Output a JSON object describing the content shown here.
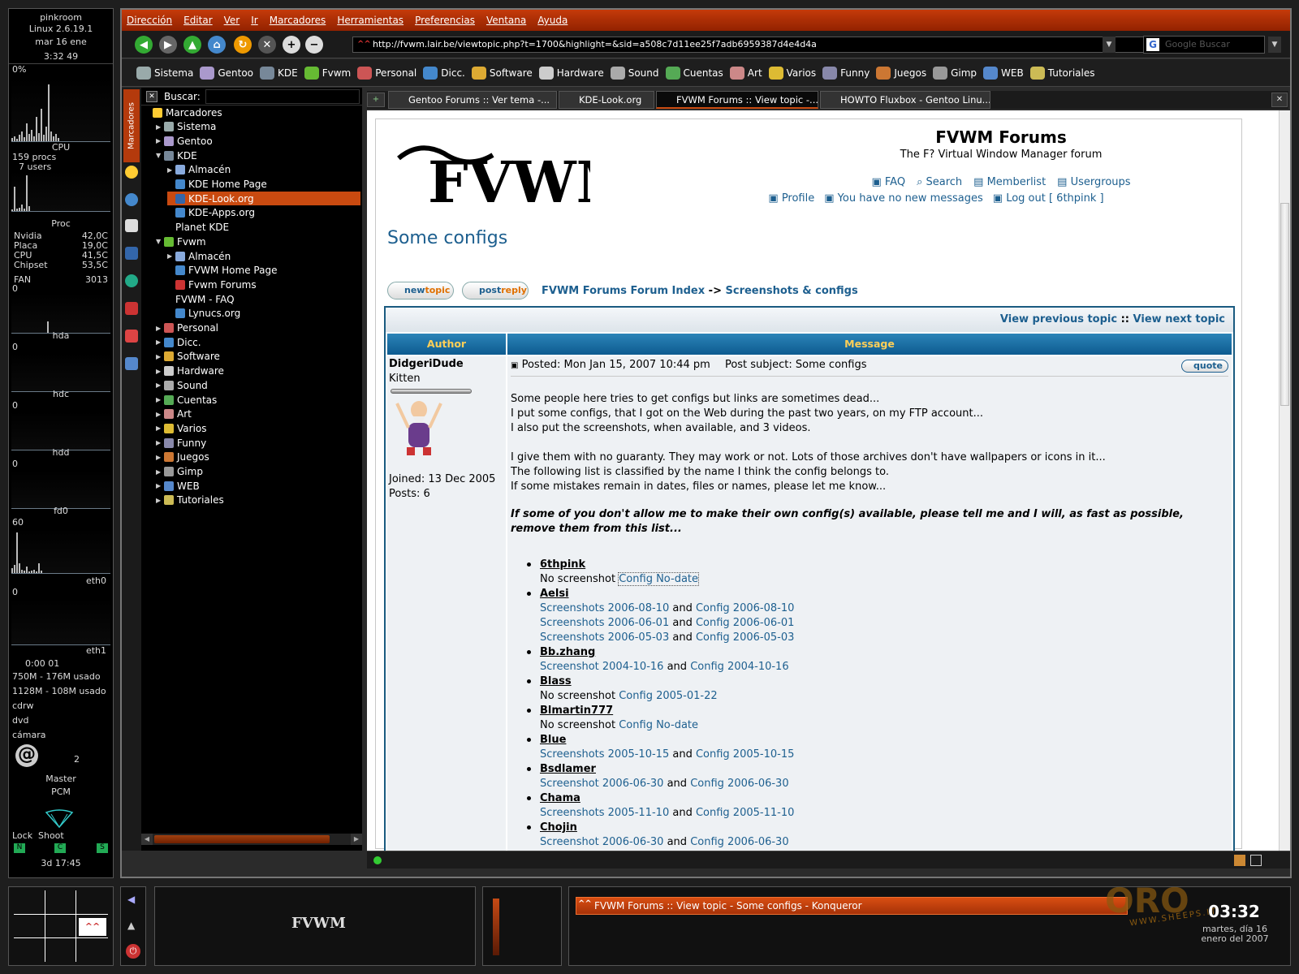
{
  "conky": {
    "host": "pinkroom",
    "kernel": "Linux 2.6.19.1",
    "date": "mar 16 ene",
    "time": "3:32 49",
    "cpu_pct": "0%",
    "cpu_label": "CPU",
    "procs": "159 procs",
    "users": "7 users",
    "proc_label": "Proc",
    "temps": [
      {
        "k": "Nvidia",
        "v": "42,0C"
      },
      {
        "k": "Placa",
        "v": "19,0C"
      },
      {
        "k": "CPU",
        "v": "41,5C"
      },
      {
        "k": "Chipset",
        "v": "53,5C"
      },
      {
        "k": "FAN",
        "v": "3013"
      }
    ],
    "disk_zero": "0",
    "hda": "hda",
    "hdc": "hdc",
    "hdd": "hdd",
    "fd0": "fd0",
    "net_max": "60",
    "eth0": "eth0",
    "eth1": "eth1",
    "uptime_small": "0:00 01",
    "mem1": "750M - 176M usado",
    "mem2": "1128M - 108M usado",
    "dev1": "cdrw",
    "dev2": "dvd",
    "dev3": "cámara",
    "mail_count": "2",
    "mixer1": "Master",
    "mixer2": "PCM",
    "lock": "Lock",
    "shoot": "Shoot",
    "keys": [
      "N",
      "C",
      "S"
    ],
    "uptime": "3d 17:45"
  },
  "menu": [
    "Dirección",
    "Editar",
    "Ver",
    "Ir",
    "Marcadores",
    "Herramientas",
    "Preferencias",
    "Ventana",
    "Ayuda"
  ],
  "url": "http://fvwm.lair.be/viewtopic.php?t=1700&highlight=&sid=a508c7d11ee25f7adb6959387d4e4d4a",
  "google_placeholder": "Google Buscar",
  "bookbar": [
    {
      "label": "Sistema",
      "color": "#9aa"
    },
    {
      "label": "Gentoo",
      "color": "#a9c"
    },
    {
      "label": "KDE",
      "color": "#789"
    },
    {
      "label": "Fvwm",
      "color": "#6b3"
    },
    {
      "label": "Personal",
      "color": "#c55"
    },
    {
      "label": "Dicc.",
      "color": "#48c"
    },
    {
      "label": "Software",
      "color": "#da3"
    },
    {
      "label": "Hardware",
      "color": "#ccc"
    },
    {
      "label": "Sound",
      "color": "#aaa"
    },
    {
      "label": "Cuentas",
      "color": "#5a5"
    },
    {
      "label": "Art",
      "color": "#c88"
    },
    {
      "label": "Varios",
      "color": "#db3"
    },
    {
      "label": "Funny",
      "color": "#88a"
    },
    {
      "label": "Juegos",
      "color": "#c73"
    },
    {
      "label": "Gimp",
      "color": "#999"
    },
    {
      "label": "WEB",
      "color": "#58c"
    },
    {
      "label": "Tutoriales",
      "color": "#cb5"
    }
  ],
  "sidebar_tab": "Marcadores",
  "tree": {
    "search_label": "Buscar:",
    "rows": [
      {
        "label": "Marcadores",
        "depth": 0,
        "arrow": "",
        "color": "#fc3"
      },
      {
        "label": "Sistema",
        "depth": 1,
        "arrow": "▶",
        "color": "#9aa"
      },
      {
        "label": "Gentoo",
        "depth": 1,
        "arrow": "▶",
        "color": "#a9c"
      },
      {
        "label": "KDE",
        "depth": 1,
        "arrow": "▼",
        "color": "#789"
      },
      {
        "label": "Almacén",
        "depth": 2,
        "arrow": "▶",
        "color": "#8ad"
      },
      {
        "label": "KDE Home Page",
        "depth": 2,
        "arrow": "",
        "color": "#48c"
      },
      {
        "label": "KDE-Look.org",
        "depth": 2,
        "arrow": "",
        "color": "#36a",
        "selected": true
      },
      {
        "label": "KDE-Apps.org",
        "depth": 2,
        "arrow": "",
        "color": "#48c"
      },
      {
        "label": "Planet KDE",
        "depth": 2,
        "arrow": "",
        "color": ""
      },
      {
        "label": "Fvwm",
        "depth": 1,
        "arrow": "▼",
        "color": "#6b3"
      },
      {
        "label": "Almacén",
        "depth": 2,
        "arrow": "▶",
        "color": "#8ad"
      },
      {
        "label": "FVWM Home Page",
        "depth": 2,
        "arrow": "",
        "color": "#48c"
      },
      {
        "label": "Fvwm Forums",
        "depth": 2,
        "arrow": "",
        "color": "#c33"
      },
      {
        "label": "FVWM - FAQ",
        "depth": 2,
        "arrow": "",
        "color": ""
      },
      {
        "label": "Lynucs.org",
        "depth": 2,
        "arrow": "",
        "color": "#48c"
      },
      {
        "label": "Personal",
        "depth": 1,
        "arrow": "▶",
        "color": "#c55"
      },
      {
        "label": "Dicc.",
        "depth": 1,
        "arrow": "▶",
        "color": "#48c"
      },
      {
        "label": "Software",
        "depth": 1,
        "arrow": "▶",
        "color": "#da3"
      },
      {
        "label": "Hardware",
        "depth": 1,
        "arrow": "▶",
        "color": "#ccc"
      },
      {
        "label": "Sound",
        "depth": 1,
        "arrow": "▶",
        "color": "#aaa"
      },
      {
        "label": "Cuentas",
        "depth": 1,
        "arrow": "▶",
        "color": "#5a5"
      },
      {
        "label": "Art",
        "depth": 1,
        "arrow": "▶",
        "color": "#c88"
      },
      {
        "label": "Varios",
        "depth": 1,
        "arrow": "▶",
        "color": "#db3"
      },
      {
        "label": "Funny",
        "depth": 1,
        "arrow": "▶",
        "color": "#88a"
      },
      {
        "label": "Juegos",
        "depth": 1,
        "arrow": "▶",
        "color": "#c73"
      },
      {
        "label": "Gimp",
        "depth": 1,
        "arrow": "▶",
        "color": "#999"
      },
      {
        "label": "WEB",
        "depth": 1,
        "arrow": "▶",
        "color": "#58c"
      },
      {
        "label": "Tutoriales",
        "depth": 1,
        "arrow": "▶",
        "color": "#cb5"
      }
    ]
  },
  "tabs": [
    {
      "label": "Gentoo Forums :: Ver tema -...",
      "active": false
    },
    {
      "label": "KDE-Look.org",
      "active": false
    },
    {
      "label": "FVWM Forums :: View topic -...",
      "active": true
    },
    {
      "label": "HOWTO Fluxbox - Gentoo Linu...",
      "active": false
    }
  ],
  "forum": {
    "logo": "FVWM",
    "title": "FVWM Forums",
    "subtitle": "The F? Virtual Window Manager forum",
    "nav1": [
      "FAQ",
      "Search",
      "Memberlist",
      "Usergroups"
    ],
    "nav2": [
      "Profile",
      "You have no new messages",
      "Log out [ 6thpink ]"
    ],
    "topic_title": "Some configs",
    "newtopic_a": "new",
    "newtopic_b": "topic",
    "postreply_a": "post",
    "postreply_b": "reply",
    "crumb_index": "FVWM Forums Forum Index",
    "crumb_sep": "->",
    "crumb_forum": "Screenshots & configs",
    "view_prev": "View previous topic",
    "view_sep": "::",
    "view_next": "View next topic",
    "col_author": "Author",
    "col_message": "Message",
    "author": "DidgeriDude",
    "rank": "Kitten",
    "joined": "Joined: 13 Dec 2005",
    "posts": "Posts: 6",
    "posted": "Posted: Mon Jan 15, 2007 10:44 pm",
    "subject": "Post subject: Some configs",
    "quote": "quote",
    "para1": [
      "Some people here tries to get configs but links are sometimes dead...",
      "I put some configs, that I got on the Web during the past two years, on my FTP account...",
      "I also put the screenshots, when available, and 3 videos."
    ],
    "para2": [
      "I give them with no guaranty. They may work or not. Lots of those archives don't have wallpapers or icons in it...",
      "The following list is classified by the name I think the config belongs to.",
      "If some mistakes remain in dates, files or names, please let me know..."
    ],
    "warning": "If some of you don't allow me to make their own config(s) available, please tell me and I will, as fast as possible, remove them from this list...",
    "entries": [
      {
        "name": "6thpink",
        "lines": [
          {
            "pre": "No screenshot",
            "link1": "",
            "and": "",
            "link2": "Config No-date"
          }
        ]
      },
      {
        "name": "Aelsi",
        "lines": [
          {
            "pre": "",
            "link1": "Screenshots 2006-08-10",
            "and": "and",
            "link2": "Config 2006-08-10"
          },
          {
            "pre": "",
            "link1": "Screenshots 2006-06-01",
            "and": "and",
            "link2": "Config 2006-06-01"
          },
          {
            "pre": "",
            "link1": "Screenshots 2006-05-03",
            "and": "and",
            "link2": "Config 2006-05-03"
          }
        ]
      },
      {
        "name": "Bb.zhang",
        "lines": [
          {
            "pre": "",
            "link1": "Screenshot 2004-10-16",
            "and": "and",
            "link2": "Config 2004-10-16"
          }
        ]
      },
      {
        "name": "Blass",
        "lines": [
          {
            "pre": "No screenshot",
            "link1": "",
            "and": "",
            "link2": "Config 2005-01-22"
          }
        ]
      },
      {
        "name": "Blmartin777",
        "lines": [
          {
            "pre": "No screenshot",
            "link1": "",
            "and": "",
            "link2": "Config No-date"
          }
        ]
      },
      {
        "name": "Blue",
        "lines": [
          {
            "pre": "",
            "link1": "Screenshots 2005-10-15",
            "and": "and",
            "link2": "Config 2005-10-15"
          }
        ]
      },
      {
        "name": "Bsdlamer",
        "lines": [
          {
            "pre": "",
            "link1": "Screenshot 2006-06-30",
            "and": "and",
            "link2": "Config 2006-06-30"
          }
        ]
      },
      {
        "name": "Chama",
        "lines": [
          {
            "pre": "",
            "link1": "Screenshots 2005-11-10",
            "and": "and",
            "link2": "Config 2005-11-10"
          }
        ]
      },
      {
        "name": "Chojin",
        "lines": [
          {
            "pre": "",
            "link1": "Screenshot 2006-06-30",
            "and": "and",
            "link2": "Config 2006-06-30"
          }
        ]
      }
    ]
  },
  "taskbar": {
    "fvwm_logo": "FVWM",
    "task": "FVWM Forums :: View topic - Some configs - Konqueror",
    "clock": "03:32",
    "date1": "martes, día 16",
    "date2": "enero del 2007",
    "watermark": "WWW.SHEEPS.IT"
  }
}
